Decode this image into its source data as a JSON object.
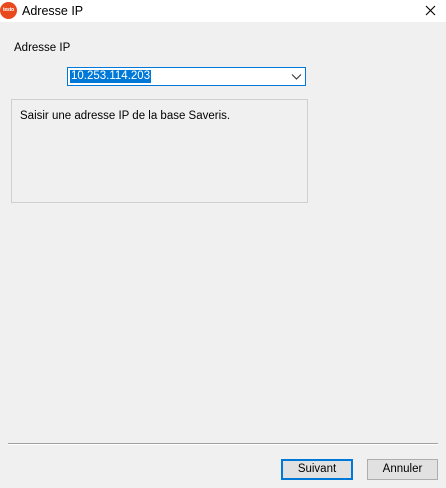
{
  "window": {
    "title": "Adresse IP",
    "app_icon_text": "testo"
  },
  "form": {
    "label": "Adresse IP",
    "ip_value": "10.253.114.203",
    "info_text": "Saisir une adresse IP de la base Saveris."
  },
  "buttons": {
    "next_label": "Suivant",
    "cancel_label": "Annuler"
  },
  "colors": {
    "accent": "#0078d7",
    "brand": "#e8491d",
    "background": "#f0f0f0"
  },
  "icons": {
    "app": "testo-logo-icon",
    "close": "close-icon",
    "dropdown": "chevron-down-icon"
  }
}
